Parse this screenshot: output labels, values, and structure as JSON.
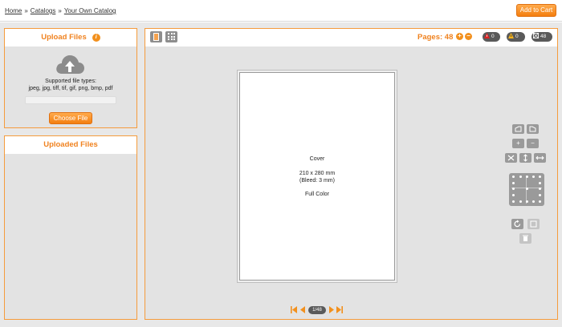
{
  "breadcrumb": {
    "home": "Home",
    "catalogs": "Catalogs",
    "current": "Your Own Catalog",
    "separator": "»"
  },
  "header": {
    "add_to_cart": "Add to Cart"
  },
  "upload_panel": {
    "title": "Upload Files",
    "info_icon": "i",
    "types_label": "Supported file types:",
    "types_list": "jpeg, jpg, tiff, tif, gif, png, bmp, pdf",
    "choose_button": "Choose File"
  },
  "uploaded_panel": {
    "title": "Uploaded Files"
  },
  "editor": {
    "pages_label": "Pages: 48",
    "plus": "+",
    "minus": "−",
    "badges": {
      "errors": "0",
      "warnings": "0",
      "pages": "48"
    },
    "page": {
      "name": "Cover",
      "size": "210 x 280 mm",
      "bleed": "(Bleed: 3 mm)",
      "color": "Full Color"
    },
    "nav": {
      "indicator": "1/48"
    }
  },
  "colors": {
    "accent": "#f0821f",
    "panel_border": "#f59b3c",
    "tool_gray": "#9a9a9a"
  }
}
